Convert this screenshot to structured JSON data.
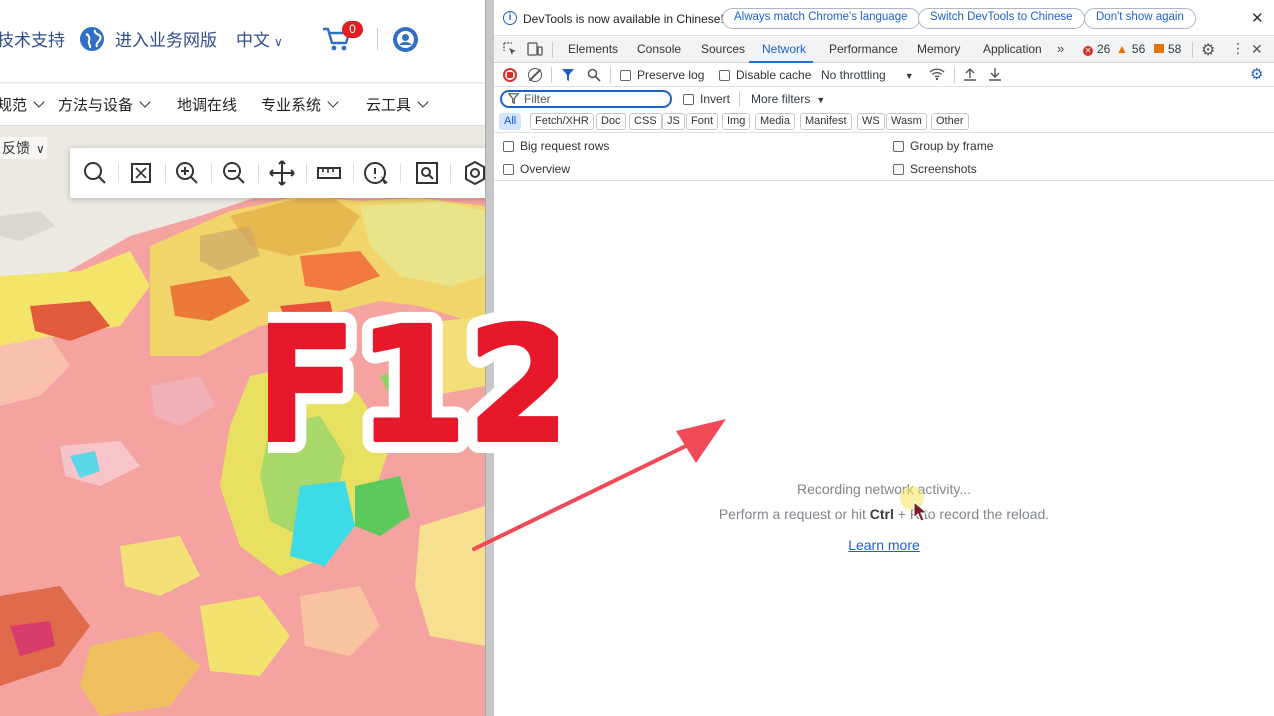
{
  "website": {
    "topbar": {
      "tech_support": "技术支持",
      "business_site": "进入业务网版",
      "language": "中文",
      "cart_count": "0"
    },
    "nav": {
      "items": [
        "规范",
        "方法与设备",
        "地调在线",
        "专业系统",
        "云工具"
      ]
    },
    "feedback": "反馈",
    "map_tools": [
      "search-icon",
      "full-extent-icon",
      "zoom-in-icon",
      "zoom-out-icon",
      "pan-icon",
      "measure-icon",
      "identify-icon",
      "zoom-box-icon",
      "locate-icon"
    ]
  },
  "devtools": {
    "infobar": {
      "message": "DevTools is now available in Chinese!",
      "btn_match": "Always match Chrome's language",
      "btn_switch": "Switch DevTools to Chinese",
      "btn_dismiss": "Don't show again"
    },
    "tabs": [
      "Elements",
      "Console",
      "Sources",
      "Network",
      "Performance",
      "Memory",
      "Application"
    ],
    "active_tab": "Network",
    "counts": {
      "errors": "26",
      "warnings": "56",
      "issues": "58"
    },
    "netbar": {
      "preserve_log": "Preserve log",
      "disable_cache": "Disable cache",
      "throttling": "No throttling"
    },
    "filter": {
      "placeholder": "Filter",
      "invert": "Invert",
      "more_filters": "More filters"
    },
    "types": [
      "All",
      "Fetch/XHR",
      "Doc",
      "CSS",
      "JS",
      "Font",
      "Img",
      "Media",
      "Manifest",
      "WS",
      "Wasm",
      "Other"
    ],
    "options": {
      "big_rows": "Big request rows",
      "group_frame": "Group by frame",
      "overview": "Overview",
      "screenshots": "Screenshots"
    },
    "empty": {
      "line1": "Recording network activity...",
      "line2_pre": "Perform a request or hit ",
      "line2_key": "Ctrl",
      "line2_post": " + R to record the reload.",
      "learn_more": "Learn more"
    }
  },
  "overlay": {
    "key_label": "F12",
    "colors": {
      "key_red": "#e8182b",
      "arrow": "#ef4a55"
    }
  }
}
